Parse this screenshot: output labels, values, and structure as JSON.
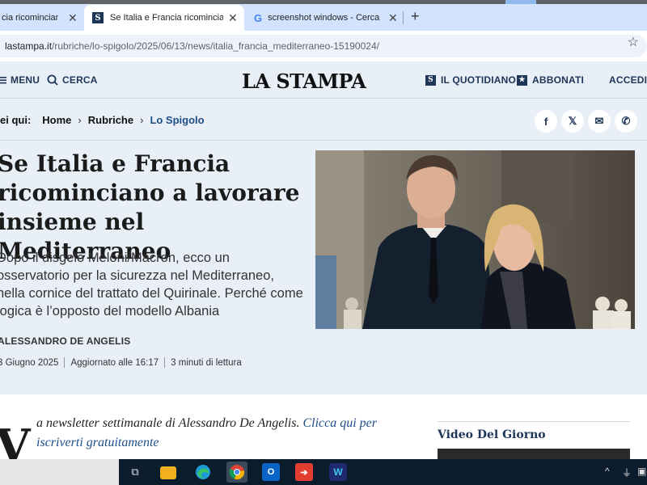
{
  "browser": {
    "tabs": [
      {
        "title": "cia ricominciano",
        "close": "✕"
      },
      {
        "title": "Se Italia e Francia ricominciano",
        "favicon": "S",
        "close": "✕"
      },
      {
        "title": "screenshot windows - Cerca co",
        "favicon": "G",
        "close": "✕"
      }
    ],
    "new_tab": "+",
    "url_host": "lastampa.it",
    "url_path": "/rubriche/lo-spigolo/2025/06/13/news/italia_francia_mediterraneo-15190024/"
  },
  "site": {
    "menu": "MENU",
    "search": "CERCA",
    "logo": "LA STAMPA",
    "quotidiano": "IL QUOTIDIANO",
    "quotidiano_icon": "S",
    "abbonati": "ABBONATI",
    "accedi": "ACCEDI"
  },
  "breadcrumb": {
    "label": "ei qui:",
    "items": [
      "Home",
      "Rubriche",
      "Lo Spigolo"
    ],
    "sep": "›"
  },
  "share": {
    "facebook": "f",
    "x": "𝕏",
    "email": "✉",
    "whatsapp": "✆"
  },
  "article": {
    "headline": "Se Italia e Francia ricominciano a lavorare insieme nel Mediterraneo",
    "summary": "Dopo il disgelo Meloni/Macron, ecco un osservatorio per la sicurezza nel Mediterraneo, nella cornice del trattato del Quirinale. Perché come logica è l’opposto del modello Albania",
    "author": "ALESSANDRO DE ANGELIS",
    "date": "3 Giugno 2025",
    "updated": "Aggiornato alle 16:17",
    "reading": "3 minuti di lettura",
    "dropcap": "V",
    "newsletter_text": "a newsletter settimanale di Alessandro De Angelis. ",
    "newsletter_link": "Clicca qui per iscriverti gratuitamente"
  },
  "sidebar": {
    "video_title": "Video Del Giorno"
  },
  "colors": {
    "brand_navy": "#1d3557",
    "link_blue": "#1d4e89",
    "page_bg": "#e9eff7"
  }
}
